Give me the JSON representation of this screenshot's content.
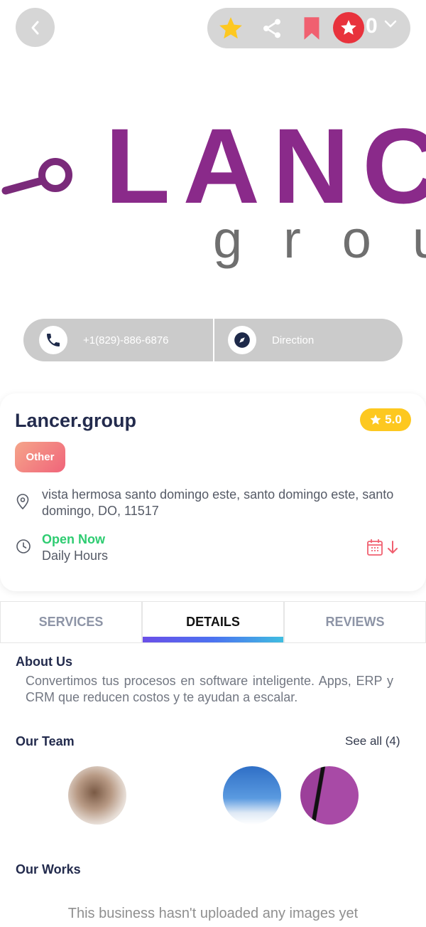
{
  "header": {
    "action_count": "0"
  },
  "hero": {
    "logo_text": "LANCE",
    "logo_subtext": "group"
  },
  "contact": {
    "phone": "+1(829)-886-6876",
    "direction": "Direction"
  },
  "business": {
    "name": "Lancer.group",
    "rating": "5.0",
    "category": "Other",
    "address": "vista hermosa santo domingo este, santo domingo este, santo domingo, DO, 11517",
    "open_status": "Open Now",
    "hours": "Daily Hours"
  },
  "tabs": [
    {
      "label": "SERVICES"
    },
    {
      "label": "DETAILS"
    },
    {
      "label": "REVIEWS"
    }
  ],
  "about": {
    "title": "About Us",
    "text": "Convertimos tus procesos en software inteligente. Apps, ERP y CRM que reducen costos y te ayudan a escalar."
  },
  "team": {
    "title": "Our Team",
    "see_all": "See all (4)"
  },
  "works": {
    "title": "Our Works",
    "empty_text": "This business hasn't uploaded any images yet"
  },
  "colors": {
    "accent_red": "#e8323c",
    "rating_yellow": "#fdc820",
    "open_green": "#2ecc71",
    "logo_purple": "#8a2a8a",
    "title_navy": "#232b4d"
  },
  "icons": [
    "chevron-left-icon",
    "star-icon",
    "share-icon",
    "bookmark-icon",
    "rate-star-icon",
    "chevron-down-icon",
    "phone-icon",
    "compass-icon",
    "location-pin-icon",
    "clock-icon",
    "calendar-download-icon"
  ]
}
